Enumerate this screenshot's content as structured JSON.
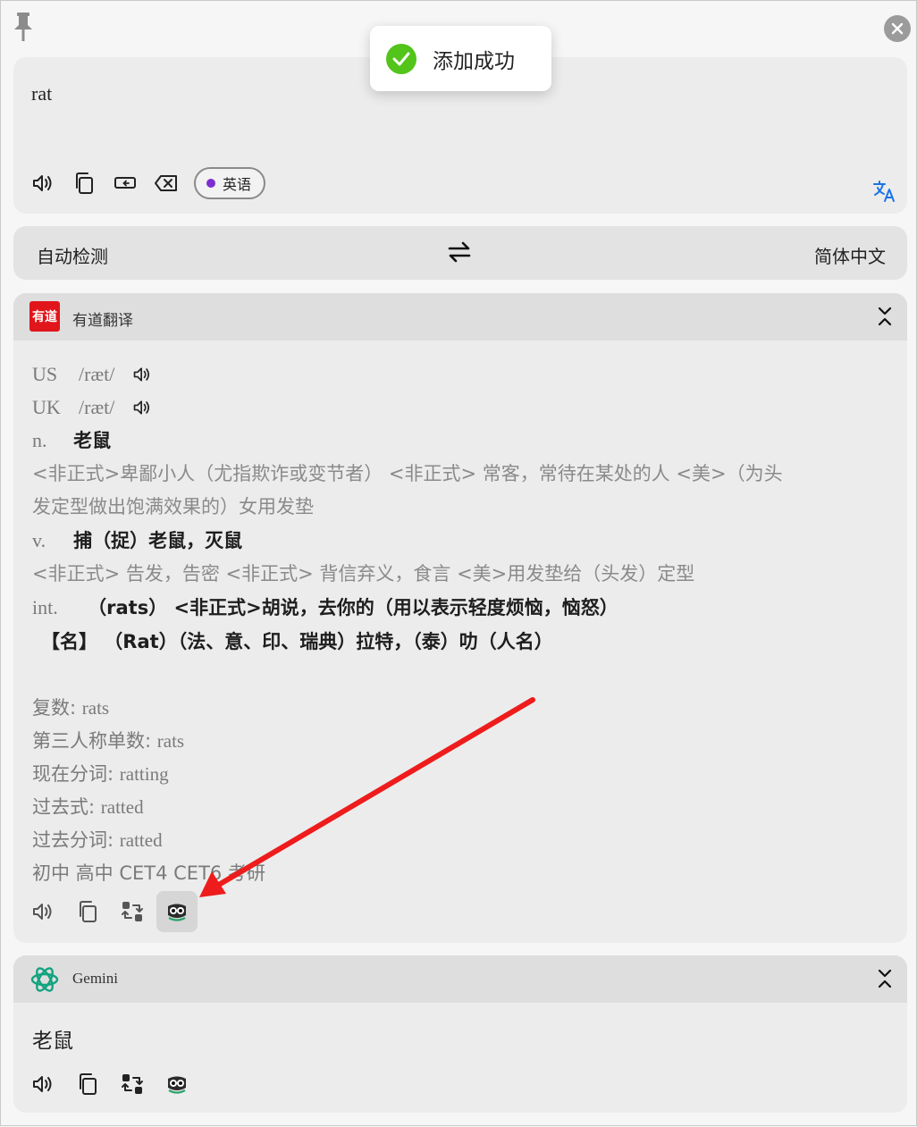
{
  "toast": {
    "message": "添加成功",
    "icon": "check-circle-icon",
    "color": "#52c41a"
  },
  "input": {
    "text": "rat",
    "detected_language": "英语",
    "detected_language_dot_color": "#7e2fd0",
    "icons": [
      "speaker-icon",
      "copy-icon",
      "line-wrap-icon",
      "clear-icon"
    ],
    "translate_icon": "translate-icon"
  },
  "language_bar": {
    "source": "自动检测",
    "target": "简体中文",
    "swap_icon": "swap-arrows-icon"
  },
  "youdao": {
    "logo_text": "有道",
    "name": "有道翻译",
    "brand_color": "#e0161b",
    "phonetics": [
      {
        "tag": "US",
        "ipa": "/ræt/"
      },
      {
        "tag": "UK",
        "ipa": "/ræt/"
      }
    ],
    "definitions": {
      "n_pos": "n.",
      "n_main": "老鼠",
      "n_extra_1": "<非正式>卑鄙小人（尤指欺诈或变节者） <非正式> 常客，常待在某处的人 <美>（为头",
      "n_extra_2": "发定型做出饱满效果的）女用发垫",
      "v_pos": "v.",
      "v_main": "捕（捉）老鼠，灭鼠",
      "v_extra": "<非正式> 告发，告密 <非正式> 背信弃义，食言 <美>用发垫给（头发）定型",
      "int_pos": "int.",
      "int_main": "（rats） <非正式>胡说，去你的（用以表示轻度烦恼，恼怒）",
      "name_main": "【名】 （Rat）（法、意、印、瑞典）拉特，（泰）叻（人名）"
    },
    "forms": [
      {
        "label": "复数: ",
        "value": "rats"
      },
      {
        "label": "第三人称单数: ",
        "value": "rats"
      },
      {
        "label": "现在分词: ",
        "value": "ratting"
      },
      {
        "label": "过去式: ",
        "value": "ratted"
      },
      {
        "label": "过去分词: ",
        "value": "ratted"
      }
    ],
    "levels": "初中 高中 CET4 CET6 考研",
    "icons": [
      "speaker-icon",
      "copy-icon",
      "retranslate-icon",
      "eudic-owl-icon"
    ]
  },
  "gemini": {
    "name": "Gemini",
    "result": "老鼠",
    "logo_color": "#10a37f",
    "icons": [
      "speaker-icon",
      "copy-icon",
      "retranslate-icon",
      "eudic-owl-icon"
    ]
  },
  "annotation_color": "#ee1c1c"
}
